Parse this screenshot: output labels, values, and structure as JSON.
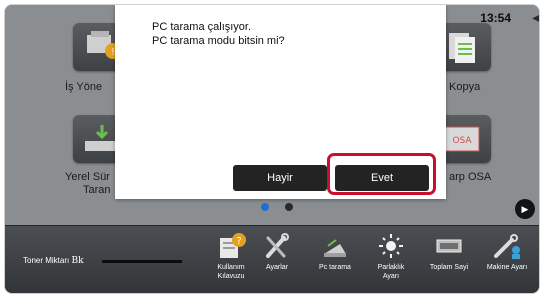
{
  "status": {
    "clock": "13:54"
  },
  "home": {
    "apps": [
      {
        "label": "İş Yöne",
        "icon": "job-status-icon"
      },
      {
        "label": "Kopya",
        "icon": "copy-icon"
      },
      {
        "label": "Yerel Sür",
        "label2": "Taran",
        "icon": "local-drive-scan-icon"
      },
      {
        "label": "arp OSA",
        "icon": "sharp-osa-icon"
      }
    ],
    "pager": {
      "pages": 2,
      "current": 1
    }
  },
  "dialog": {
    "line1": "PC tarama çalışıyor.",
    "line2": "PC tarama modu bitsin mi?",
    "no_label": "Hayir",
    "yes_label": "Evet"
  },
  "toolbar": {
    "toner_label": "Toner Miktarı",
    "toner_color": "Bk",
    "items": [
      {
        "label": "Kullanım",
        "label2": "Kılavuzu",
        "icon": "user-guide-icon"
      },
      {
        "label": "Ayarlar",
        "icon": "settings-icon"
      },
      {
        "label": "Pc tarama",
        "icon": "pc-scan-icon"
      },
      {
        "label": "Parlaklık",
        "label2": "Ayarı",
        "icon": "brightness-icon"
      },
      {
        "label": "Toplam Sayi",
        "icon": "total-count-icon"
      },
      {
        "label": "Makine Ayarı",
        "icon": "machine-settings-icon"
      }
    ]
  },
  "colors": {
    "accent": "#c8102e",
    "button": "#232323",
    "dim": "#8b8e91"
  }
}
